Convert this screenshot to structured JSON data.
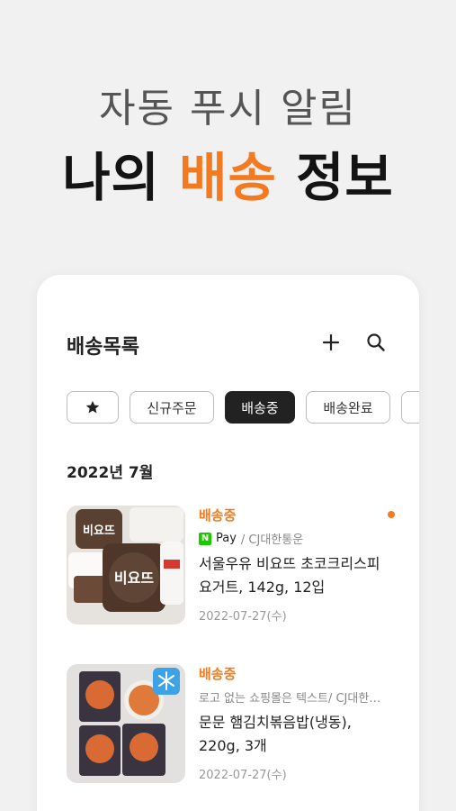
{
  "hero": {
    "subtitle": "자동 푸시 알림",
    "title_prefix": "나의",
    "title_accent": "배송",
    "title_suffix": "정보"
  },
  "card": {
    "title": "배송목록",
    "add_icon": "plus-icon",
    "search_icon": "search-icon"
  },
  "filters": {
    "star_icon": "star-icon",
    "items": [
      "신규주문",
      "배송중",
      "배송완료"
    ],
    "active": "배송중"
  },
  "month_label": "2022년 7월",
  "orders": [
    {
      "status": "배송중",
      "pay_badge": "N",
      "pay_label": "Pay",
      "shop": "/ CJ대한통운",
      "name": "서울우유 비요뜨 초코크리스피 요거트, 142g, 12입",
      "date": "2022-07-27(수)",
      "unread": true
    },
    {
      "status": "배송중",
      "shop": "로고 없는 쇼핑몰은 텍스트/ CJ대한…",
      "name": "문문 햄김치볶음밥(냉동), 220g, 3개",
      "date": "2022-07-27(수)",
      "frozen_label": "냉동",
      "unread": false
    }
  ],
  "colors": {
    "accent": "#f47a20",
    "background": "#f1f1f1",
    "npay": "#1ec800"
  }
}
